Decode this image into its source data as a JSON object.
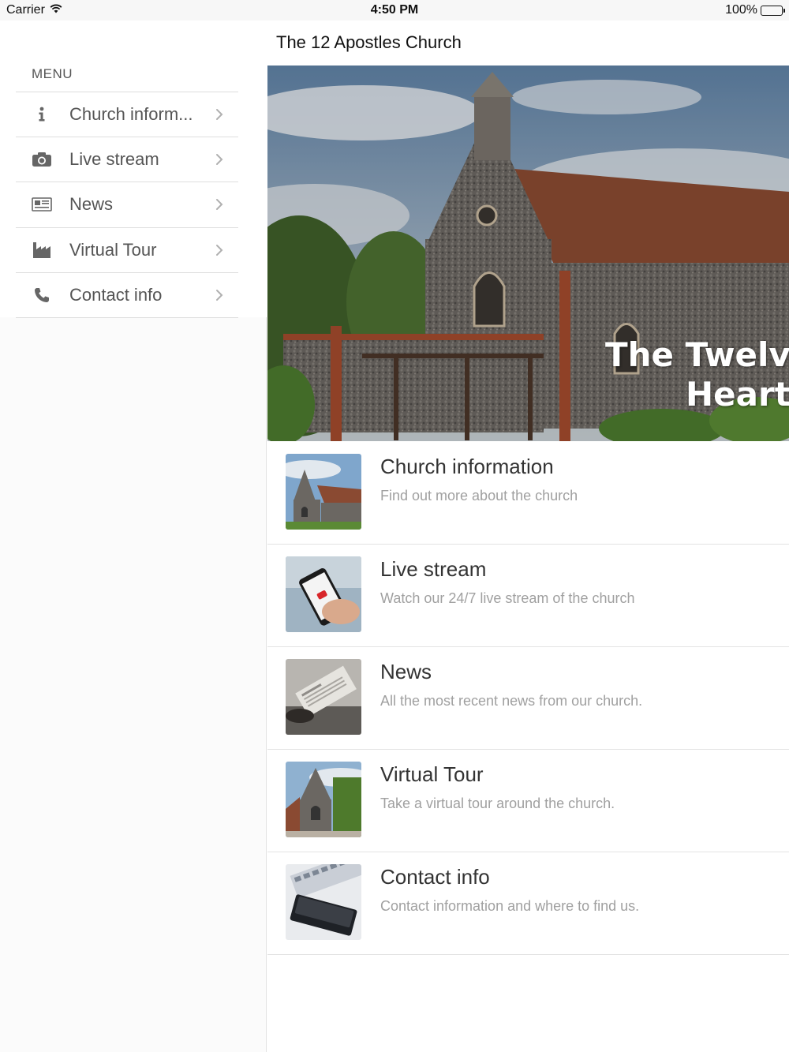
{
  "status_bar": {
    "carrier": "Carrier",
    "time": "4:50 PM",
    "battery": "100%"
  },
  "sidebar": {
    "heading": "MENU",
    "items": [
      {
        "label": "Church inform...",
        "icon": "info-icon"
      },
      {
        "label": "Live stream",
        "icon": "camera-icon"
      },
      {
        "label": "News",
        "icon": "newspaper-icon"
      },
      {
        "label": "Virtual Tour",
        "icon": "factory-icon"
      },
      {
        "label": "Contact info",
        "icon": "phone-icon"
      }
    ]
  },
  "nav": {
    "title": "The 12 Apostles Church"
  },
  "hero": {
    "line1": "The Twelve A",
    "line2": "Heartfo"
  },
  "content": {
    "items": [
      {
        "title": "Church information",
        "subtitle": "Find out more about the church"
      },
      {
        "title": "Live stream",
        "subtitle": "Watch our 24/7 live stream of the church"
      },
      {
        "title": "News",
        "subtitle": "All the most recent news from our church."
      },
      {
        "title": "Virtual Tour",
        "subtitle": "Take a virtual tour around the church."
      },
      {
        "title": "Contact info",
        "subtitle": "Contact information and where to find us."
      }
    ]
  },
  "colors": {
    "sidebar_icon": "#666666",
    "chevron": "#b0b0b0",
    "subtitle": "#a0a0a0"
  }
}
